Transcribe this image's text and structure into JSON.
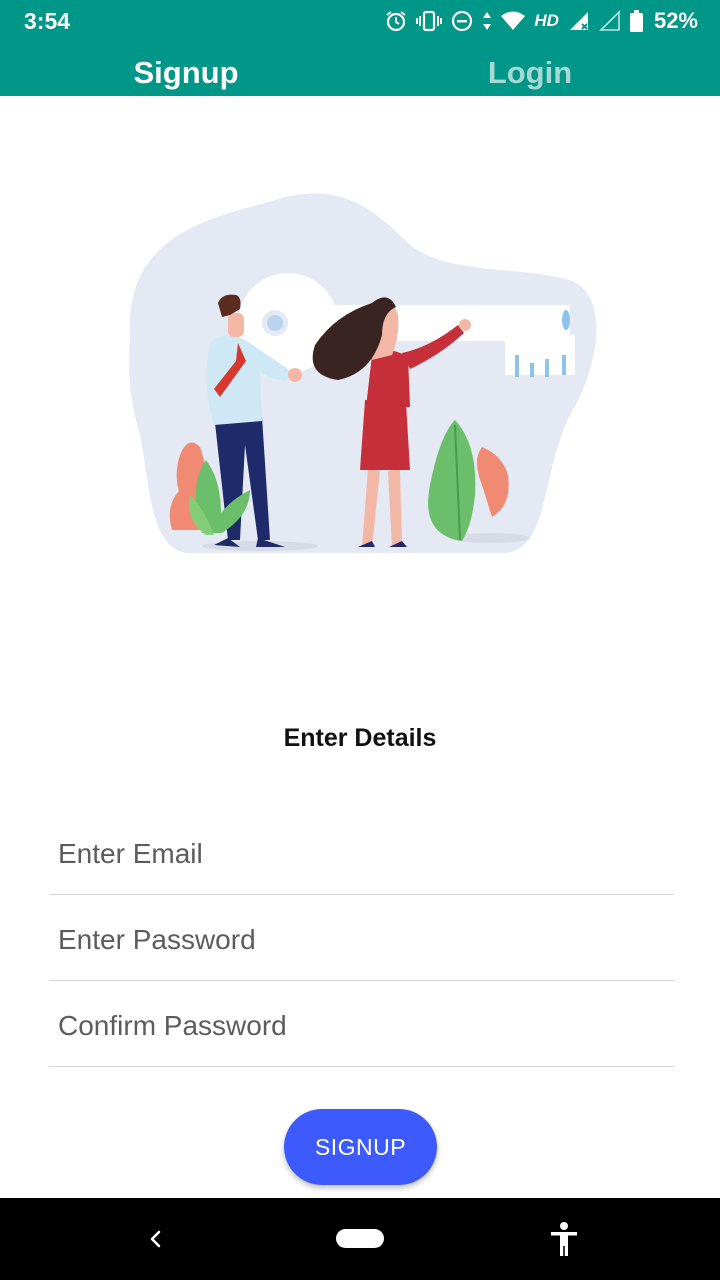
{
  "status_bar": {
    "time": "3:54",
    "network": "HD",
    "battery": "52%",
    "icons": [
      "alarm-icon",
      "vibrate-icon",
      "do-not-disturb-icon",
      "data-arrows-icon",
      "wifi-icon",
      "signal-icon",
      "signal-empty-icon",
      "battery-icon"
    ]
  },
  "tabs": [
    {
      "label": "Signup",
      "active": true
    },
    {
      "label": "Login",
      "active": false
    }
  ],
  "form": {
    "heading": "Enter Details",
    "email_placeholder": "Enter Email",
    "password_placeholder": "Enter Password",
    "confirm_placeholder": "Confirm Password",
    "submit_label": "SIGNUP"
  },
  "nav_bar": {
    "icons": [
      "back-icon",
      "home-pill-icon",
      "accessibility-icon"
    ]
  },
  "colors": {
    "primary": "#009688",
    "tab_inactive": "#a7d9d3",
    "button": "#3d5afe"
  }
}
